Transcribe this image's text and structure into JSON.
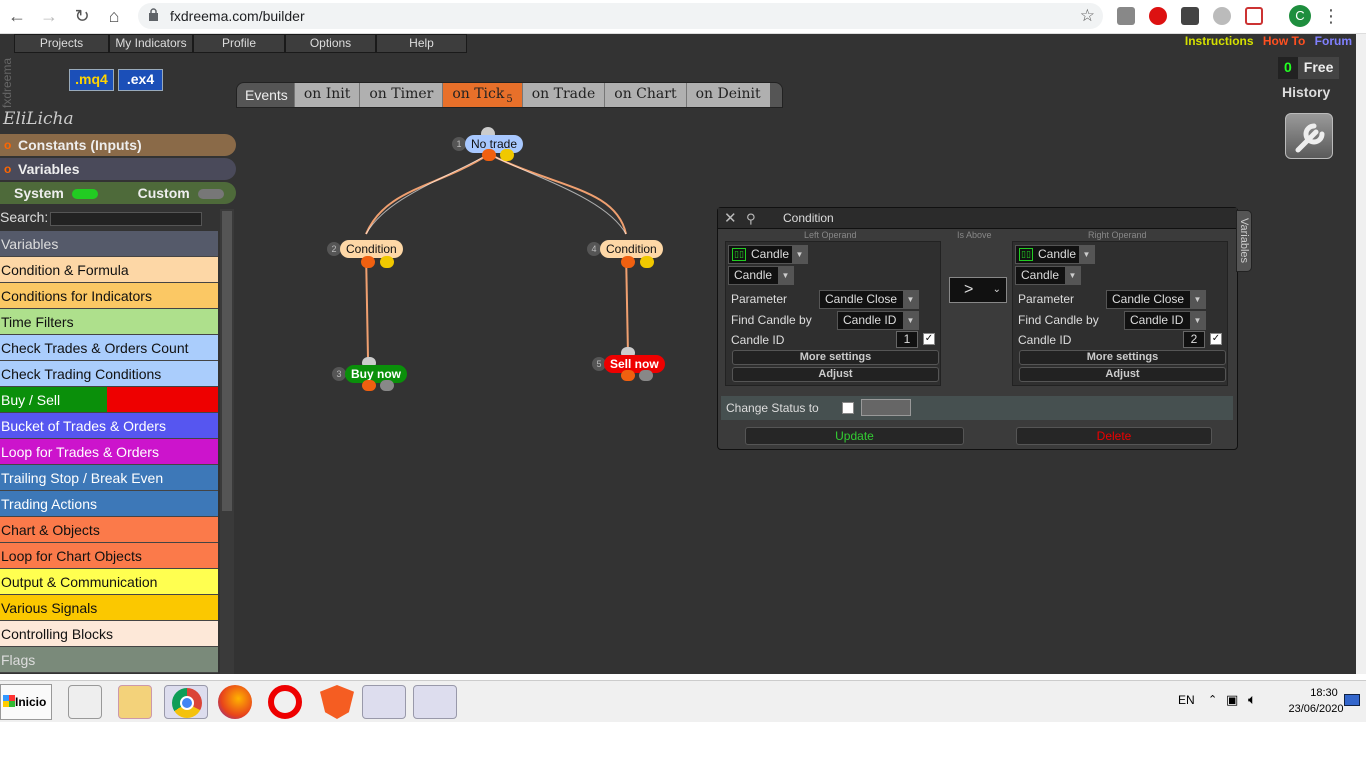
{
  "browser": {
    "url": "fxdreema.com/builder",
    "avatar_letter": "C"
  },
  "menu": {
    "items": [
      "Projects",
      "My Indicators",
      "Profile",
      "Options",
      "Help"
    ]
  },
  "brand_vertical": "fxdreema",
  "format_buttons": [
    ".mq4",
    ".ex4"
  ],
  "top_links": {
    "instructions": "Instructions",
    "howto": "How To",
    "forum": "Forum"
  },
  "plan": {
    "count": "0",
    "label": "Free"
  },
  "history_label": "History",
  "events": {
    "label": "Events",
    "tabs": [
      {
        "label": "on Init",
        "count": ""
      },
      {
        "label": "on Timer",
        "count": ""
      },
      {
        "label": "on Tick",
        "count": "5"
      },
      {
        "label": "on Trade",
        "count": ""
      },
      {
        "label": "on Chart",
        "count": ""
      },
      {
        "label": "on Deinit",
        "count": ""
      }
    ],
    "active": "on Tick"
  },
  "sidebar": {
    "username": "EliLicha",
    "constants_label": "Constants (Inputs)",
    "variables_label": "Variables",
    "system_label": "System",
    "custom_label": "Custom",
    "search_label": "Search:",
    "categories": [
      {
        "label": "Variables",
        "color": "#555a6a",
        "text_color": "#dddddd"
      },
      {
        "label": "Condition & Formula",
        "color": "#fdd7a6"
      },
      {
        "label": "Conditions for Indicators",
        "color": "#fbc864"
      },
      {
        "label": "Time Filters",
        "color": "#aee08c"
      },
      {
        "label": "Check Trades & Orders Count",
        "color": "#aacdfc"
      },
      {
        "label": "Check Trading Conditions",
        "color": "#aacdfc"
      },
      {
        "label": "Buy / Sell",
        "color": "#0a8f0a",
        "text_color": "#ffffff"
      },
      {
        "label": "Bucket of Trades & Orders",
        "color": "#5656f0",
        "text_color": "#ffffff"
      },
      {
        "label": "Loop for Trades & Orders",
        "color": "#cc14cc",
        "text_color": "#ffffff"
      },
      {
        "label": "Trailing Stop / Break Even",
        "color": "#3d78b8",
        "text_color": "#ffffff"
      },
      {
        "label": "Trading Actions",
        "color": "#3d78b8",
        "text_color": "#ffffff"
      },
      {
        "label": "Chart & Objects",
        "color": "#fb7a4a"
      },
      {
        "label": "Loop for Chart Objects",
        "color": "#fb7a4a"
      },
      {
        "label": "Output & Communication",
        "color": "#ffff50"
      },
      {
        "label": "Various Signals",
        "color": "#fbc800"
      },
      {
        "label": "Controlling Blocks",
        "color": "#fde8d8"
      },
      {
        "label": "Flags",
        "color": "#7a8a7a",
        "text_color": "#dddddd"
      }
    ]
  },
  "nodes": [
    {
      "id": "1",
      "label": "No trade"
    },
    {
      "id": "2",
      "label": "Condition"
    },
    {
      "id": "4",
      "label": "Condition"
    },
    {
      "id": "3",
      "label": "Buy now"
    },
    {
      "id": "5",
      "label": "Sell now"
    }
  ],
  "dialog": {
    "title": "Condition",
    "left_operand_label": "Left Operand",
    "is_above_label": "Is Above",
    "right_operand_label": "Right Operand",
    "operator": ">",
    "left": {
      "type": "Candle",
      "sub": "Candle",
      "parameter_label": "Parameter",
      "parameter": "Candle Close",
      "find_label": "Find Candle by",
      "find": "Candle ID",
      "id_label": "Candle ID",
      "id_value": "1"
    },
    "right": {
      "type": "Candle",
      "sub": "Candle",
      "parameter_label": "Parameter",
      "parameter": "Candle Close",
      "find_label": "Find Candle by",
      "find": "Candle ID",
      "id_label": "Candle ID",
      "id_value": "2"
    },
    "more_settings": "More settings",
    "adjust": "Adjust",
    "change_status": "Change Status to",
    "update": "Update",
    "delete": "Delete",
    "variables_tab": "Variables"
  },
  "taskbar": {
    "start": "Inicio",
    "lang": "EN",
    "time": "18:30",
    "date": "23/06/2020"
  }
}
